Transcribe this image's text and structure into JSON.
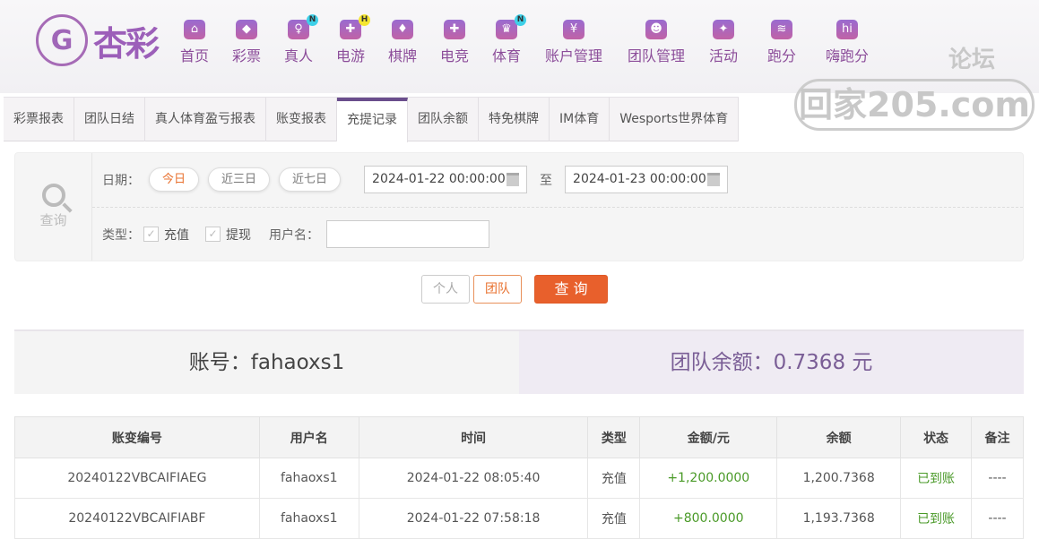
{
  "brand": {
    "logo_text": "杏彩"
  },
  "nav": [
    {
      "label": "首页",
      "icon": "home-icon",
      "glyph": "⌂"
    },
    {
      "label": "彩票",
      "icon": "ticket-icon",
      "glyph": "◆"
    },
    {
      "label": "真人",
      "icon": "live-dealer-icon",
      "glyph": "♀",
      "badge": "N"
    },
    {
      "label": "电游",
      "icon": "gamepad-icon",
      "glyph": "✚",
      "badge": "H"
    },
    {
      "label": "棋牌",
      "icon": "cards-icon",
      "glyph": "♦"
    },
    {
      "label": "电竞",
      "icon": "esports-gamepad-icon",
      "glyph": "✚"
    },
    {
      "label": "体育",
      "icon": "trophy-icon",
      "glyph": "♛",
      "badge": "N"
    },
    {
      "label": "账户管理",
      "icon": "yen-coin-icon",
      "glyph": "¥"
    },
    {
      "label": "团队管理",
      "icon": "team-icon",
      "glyph": "☻"
    },
    {
      "label": "活动",
      "icon": "gift-icon",
      "glyph": "✦"
    },
    {
      "label": "跑分",
      "icon": "rhino-icon",
      "glyph": "≋"
    },
    {
      "label": "嗨跑分",
      "icon": "hi-app-icon",
      "glyph": "hi"
    }
  ],
  "watermark": {
    "top": "论坛",
    "main": "回家205.com"
  },
  "tabs": [
    "彩票报表",
    "团队日结",
    "真人体育盈亏报表",
    "账变报表",
    "充提记录",
    "团队余额",
    "特免棋牌",
    "IM体育",
    "Wesports世界体育"
  ],
  "filter": {
    "query_label": "查询",
    "date_label": "日期：",
    "quick": [
      "今日",
      "近三日",
      "近七日"
    ],
    "start": "2024-01-22 00:00:00",
    "to": "至",
    "end": "2024-01-23 00:00:00",
    "type_label": "类型：",
    "types": [
      "充值",
      "提现"
    ],
    "username_label": "用户名：",
    "username_value": ""
  },
  "buttons": {
    "personal": "个人",
    "team": "团队",
    "search": "查 询"
  },
  "account": {
    "label": "账号：fahaoxs1",
    "balance": "团队余额：0.7368 元"
  },
  "table": {
    "headers": [
      "账变编号",
      "用户名",
      "时间",
      "类型",
      "金额/元",
      "余额",
      "状态",
      "备注"
    ],
    "rows": [
      [
        "20240122VBCAIFIAEG",
        "fahaoxs1",
        "2024-01-22 08:05:40",
        "充值",
        "+1,200.0000",
        "1,200.7368",
        "已到账",
        "----"
      ],
      [
        "20240122VBCAIFIABF",
        "fahaoxs1",
        "2024-01-22 07:58:18",
        "充值",
        "+800.0000",
        "1,193.7368",
        "已到账",
        "----"
      ]
    ]
  },
  "colors": {
    "accent": "#e8602c",
    "brand": "#9c5fb9",
    "success": "#4a9a28"
  }
}
